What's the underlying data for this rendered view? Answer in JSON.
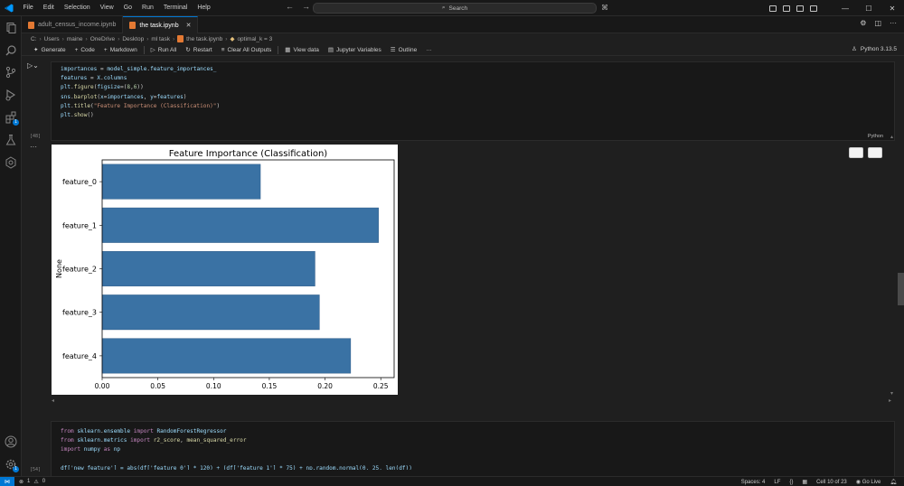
{
  "menu": [
    "File",
    "Edit",
    "Selection",
    "View",
    "Go",
    "Run",
    "Terminal",
    "Help"
  ],
  "search": {
    "placeholder": "Search"
  },
  "tabs": [
    {
      "label": "adult_census_income.ipynb",
      "active": false
    },
    {
      "label": "the task.ipynb",
      "active": true
    }
  ],
  "breadcrumb": [
    "C:",
    "Users",
    "maine",
    "OneDrive",
    "Desktop",
    "ml task",
    "the task.ipynb",
    "optimal_k = 3"
  ],
  "toolbar": {
    "generate": "Generate",
    "code": "Code",
    "markdown": "Markdown",
    "run_all": "Run All",
    "restart": "Restart",
    "clear_outputs": "Clear All Outputs",
    "view_data": "View data",
    "jupyter_variables": "Jupyter Variables",
    "outline": "Outline",
    "more": "···",
    "kernel": "Python 3.13.5"
  },
  "cell1": {
    "exec_count": "[48]",
    "lang": "Python",
    "lines": [
      "importances = model_simple.feature_importances_",
      "features = X.columns",
      "plt.figure(figsize=(8,6))",
      "sns.barplot(x=importances, y=features)",
      "plt.title(\"Feature Importance (Classification)\")",
      "plt.show()"
    ]
  },
  "cell2": {
    "exec_count": "[54]",
    "lines": [
      "from sklearn.ensemble import RandomForestRegressor",
      "from sklearn.metrics import r2_score, mean_squared_error",
      "import numpy as np",
      "",
      "df['new_feature'] = abs(df['feature_0'] * 120) + (df['feature_1'] * 75) + np.random.normal(0, 25, len(df))"
    ]
  },
  "chart_data": {
    "type": "bar",
    "orientation": "horizontal",
    "title": "Feature Importance (Classification)",
    "xlabel": "",
    "ylabel": "None",
    "categories": [
      "feature_0",
      "feature_1",
      "feature_2",
      "feature_3",
      "feature_4"
    ],
    "values": [
      0.142,
      0.248,
      0.191,
      0.195,
      0.223
    ],
    "xlim": [
      0,
      0.262
    ],
    "xticks": [
      "0.00",
      "0.05",
      "0.10",
      "0.15",
      "0.20",
      "0.25"
    ],
    "xtick_values": [
      0,
      0.05,
      0.1,
      0.15,
      0.2,
      0.25
    ],
    "bar_color": "#3a72a4",
    "grid": false
  },
  "statusbar": {
    "errors": "1",
    "warnings": "0",
    "spaces": "Spaces: 4",
    "eol": "LF",
    "cell": "Cell 10 of 23",
    "golive": "Go Live"
  },
  "colors": {
    "accent": "#0078d4",
    "background": "#1f1f1f"
  }
}
